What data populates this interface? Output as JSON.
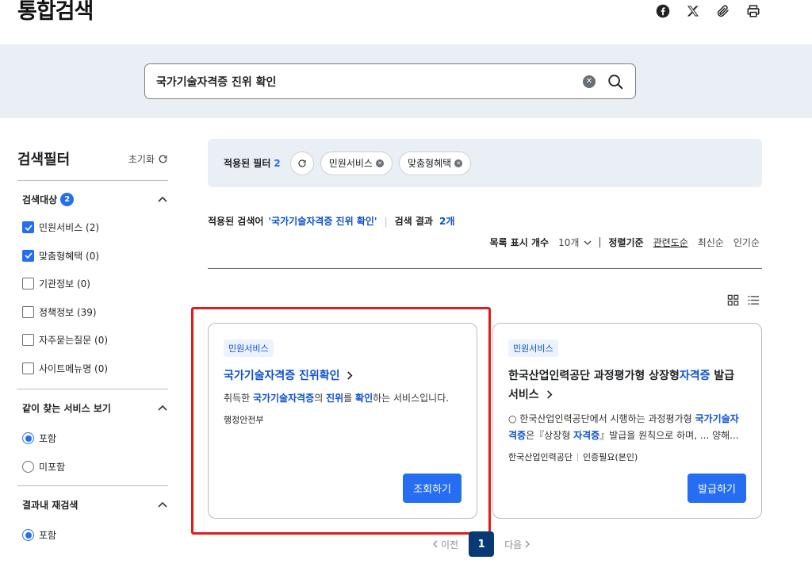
{
  "page": {
    "title": "통합검색"
  },
  "share": {
    "icons": [
      "facebook-icon",
      "x-twitter-icon",
      "attachment-icon",
      "print-icon"
    ]
  },
  "search": {
    "value": "국가기술자격증 진위 확인"
  },
  "sidebar": {
    "title": "검색필터",
    "reset_label": "초기화",
    "target": {
      "title": "검색대상",
      "badge": "2",
      "options": [
        {
          "label": "민원서비스 (2)",
          "checked": true
        },
        {
          "label": "맞춤형혜택 (0)",
          "checked": true
        },
        {
          "label": "기관정보 (0)",
          "checked": false
        },
        {
          "label": "정책정보 (39)",
          "checked": false
        },
        {
          "label": "자주묻는질문 (0)",
          "checked": false
        },
        {
          "label": "사이트메뉴명 (0)",
          "checked": false
        }
      ]
    },
    "related": {
      "title": "같이 찾는 서비스 보기",
      "options": [
        {
          "label": "포함",
          "selected": true
        },
        {
          "label": "미포함",
          "selected": false
        }
      ]
    },
    "research": {
      "title": "결과내 재검색",
      "options": [
        {
          "label": "포함",
          "selected": true
        }
      ]
    }
  },
  "filters": {
    "label": "적용된 필터",
    "count": "2",
    "chips": [
      "민원서비스",
      "맞춤형혜택"
    ]
  },
  "summary": {
    "query_label": "적용된 검색어",
    "query": "'국가기술자격증 진위 확인'",
    "result_label": "검색 결과",
    "result_count": "2개"
  },
  "sort": {
    "page_size_label": "목록 표시 개수",
    "page_size": "10개",
    "sort_label": "정렬기준",
    "options": [
      "관련도순",
      "최신순",
      "인기순"
    ],
    "active": "관련도순"
  },
  "cards": [
    {
      "tag": "민원서비스",
      "title": "국가기술자격증 진위확인",
      "desc_parts": [
        "취득한 ",
        "국가기술자격증",
        "의 ",
        "진위",
        "를 ",
        "확인",
        "하는 서비스입니다."
      ],
      "meta": [
        "행정안전부"
      ],
      "button": "조회하기"
    },
    {
      "tag": "민원서비스",
      "title_parts": [
        "한국산업인력공단 과정평가형 상장형",
        "자격증",
        " 발급 서비스"
      ],
      "desc_parts": [
        "○ 한국산업인력공단에서 시행하는 과정평가형 ",
        "국가기술자격증",
        "은『상장형 ",
        "자격증",
        "』발급을 원칙으로 하며, ... 양해..."
      ],
      "meta": [
        "한국산업인력공단",
        "인증필요(본인)"
      ],
      "button": "발급하기"
    }
  ],
  "pager": {
    "prev": "이전",
    "current": "1",
    "next": "다음"
  },
  "colors": {
    "accent": "#256ef4",
    "link": "#0b50d0",
    "highlight": "#e21b1b",
    "band": "#eaeef5",
    "pager": "#063a74"
  }
}
